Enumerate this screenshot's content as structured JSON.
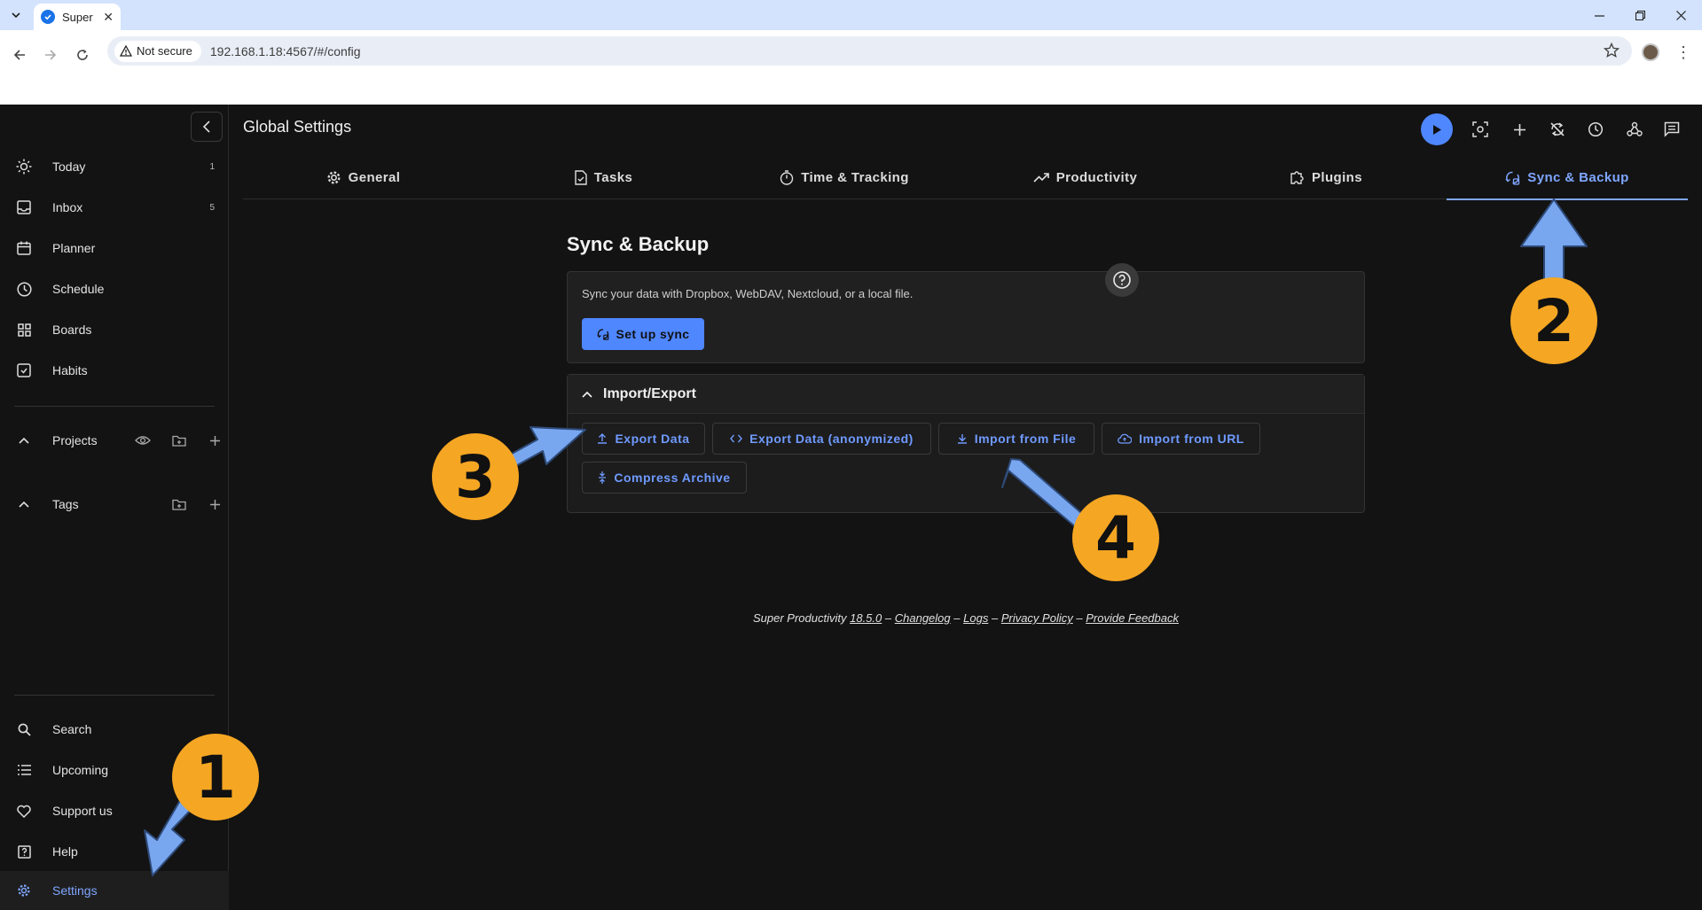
{
  "browser": {
    "tab_title": "Super",
    "security_label": "Not secure",
    "url": "192.168.1.18:4567/#/config"
  },
  "sidebar": {
    "items": [
      {
        "label": "Today",
        "count": "1",
        "icon": "sun-icon"
      },
      {
        "label": "Inbox",
        "count": "5",
        "icon": "inbox-icon"
      },
      {
        "label": "Planner",
        "icon": "calendar-icon"
      },
      {
        "label": "Schedule",
        "icon": "clock-icon"
      },
      {
        "label": "Boards",
        "icon": "grid-icon"
      },
      {
        "label": "Habits",
        "icon": "habit-icon"
      }
    ],
    "sections": [
      {
        "label": "Projects"
      },
      {
        "label": "Tags"
      }
    ],
    "bottom_items": [
      {
        "label": "Search",
        "icon": "search-icon"
      },
      {
        "label": "Upcoming",
        "icon": "list-icon"
      },
      {
        "label": "Support us",
        "icon": "heart-icon"
      },
      {
        "label": "Help",
        "icon": "help-icon"
      },
      {
        "label": "Settings",
        "icon": "gear-icon",
        "active": true
      }
    ]
  },
  "main": {
    "title": "Global Settings",
    "tabs": [
      {
        "label": "General",
        "icon": "gear-icon"
      },
      {
        "label": "Tasks",
        "icon": "task-icon"
      },
      {
        "label": "Time & Tracking",
        "icon": "timer-icon"
      },
      {
        "label": "Productivity",
        "icon": "trending-icon"
      },
      {
        "label": "Plugins",
        "icon": "puzzle-icon"
      },
      {
        "label": "Sync & Backup",
        "icon": "sync-icon",
        "active": true
      }
    ],
    "content_title": "Sync & Backup",
    "sync": {
      "description": "Sync your data with Dropbox, WebDAV, Nextcloud, or a local file.",
      "button": "Set up sync"
    },
    "import_export": {
      "title": "Import/Export",
      "buttons": [
        {
          "label": "Export Data",
          "icon": "upload-icon"
        },
        {
          "label": "Export Data (anonymized)",
          "icon": "code-icon"
        },
        {
          "label": "Import from File",
          "icon": "download-icon"
        },
        {
          "label": "Import from URL",
          "icon": "cloud-icon"
        },
        {
          "label": "Compress Archive",
          "icon": "compress-icon"
        }
      ]
    },
    "footer": {
      "app": "Super Productivity",
      "version": "18.5.0",
      "sep": "–",
      "links": [
        "Changelog",
        "Logs",
        "Privacy Policy",
        "Provide Feedback"
      ]
    }
  },
  "annotations": {
    "steps": [
      "1",
      "2",
      "3",
      "4"
    ],
    "color": "#f5a623",
    "arrow_color": "#78a6ef"
  }
}
